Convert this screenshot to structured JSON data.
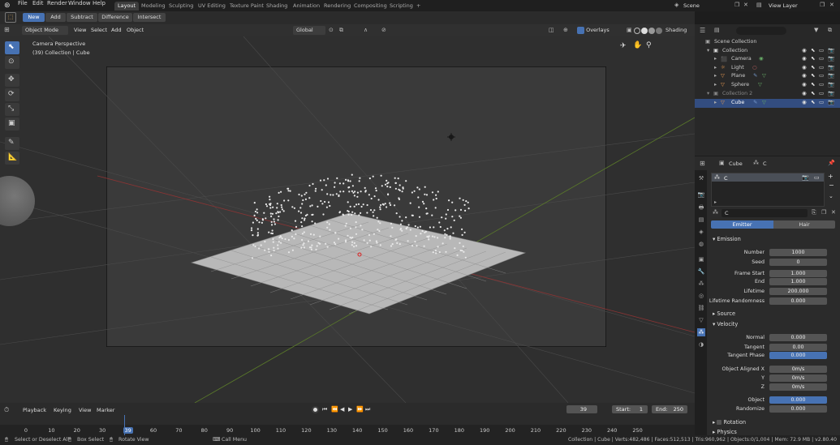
{
  "topbar": {
    "menus": [
      "File",
      "Edit",
      "Render",
      "Window",
      "Help"
    ],
    "workspaces": [
      "Layout",
      "Modeling",
      "Sculpting",
      "UV Editing",
      "Texture Paint",
      "Shading",
      "Animation",
      "Rendering",
      "Compositing",
      "Scripting"
    ],
    "active_workspace": "Layout",
    "add_workspace": "+",
    "scene_label": "Scene",
    "view_layer_label": "View Layer"
  },
  "toolheader": {
    "buttons": [
      "New",
      "Add",
      "Subtract",
      "Difference",
      "Intersect"
    ]
  },
  "viewport_header": {
    "mode": "Object Mode",
    "menus": [
      "View",
      "Select",
      "Add",
      "Object"
    ],
    "orientation": "Global",
    "overlays": "Overlays",
    "shading": "Shading"
  },
  "viewport": {
    "camera_info": "Camera Perspective",
    "collection_info": "(39) Collection | Cube"
  },
  "outliner": {
    "scene_collection": "Scene Collection",
    "items": [
      {
        "name": "Collection",
        "indent": 1
      },
      {
        "name": "Camera",
        "indent": 2
      },
      {
        "name": "Light",
        "indent": 2
      },
      {
        "name": "Plane",
        "indent": 2
      },
      {
        "name": "Sphere",
        "indent": 2
      },
      {
        "name": "Collection 2",
        "indent": 1
      },
      {
        "name": "Cube",
        "indent": 2,
        "selected": true
      }
    ]
  },
  "properties": {
    "object_name": "Cube",
    "particle_tab_label": "C",
    "slot_name": "C",
    "system_name": "C",
    "type_emitter": "Emitter",
    "type_hair": "Hair",
    "emission_header": "Emission",
    "emission": [
      {
        "label": "Number",
        "value": "1000"
      },
      {
        "label": "Seed",
        "value": "0"
      },
      {
        "label": "Frame Start",
        "value": "1.000"
      },
      {
        "label": "End",
        "value": "1.000"
      },
      {
        "label": "Lifetime",
        "value": "200.000"
      },
      {
        "label": "Lifetime Randomness",
        "value": "0.000"
      }
    ],
    "source_header": "Source",
    "velocity_header": "Velocity",
    "velocity": [
      {
        "label": "Normal",
        "value": "0.000"
      },
      {
        "label": "Tangent",
        "value": "0.00"
      },
      {
        "label": "Tangent Phase",
        "value": "0.000",
        "highlight": true
      },
      {
        "label": "Object Aligned X",
        "value": "0m/s"
      },
      {
        "label": "Y",
        "value": "0m/s"
      },
      {
        "label": "Z",
        "value": "0m/s"
      },
      {
        "label": "Object",
        "value": "0.000",
        "highlight": true
      },
      {
        "label": "Randomize",
        "value": "0.000"
      }
    ],
    "rotation_header": "Rotation",
    "physics_header": "Physics"
  },
  "timeline": {
    "menus": [
      "Playback",
      "Keying",
      "View",
      "Marker"
    ],
    "current_frame": "39",
    "start_label": "Start:",
    "start": "1",
    "end_label": "End:",
    "end": "250",
    "ticks": [
      "0",
      "10",
      "20",
      "30",
      "39",
      "60",
      "70",
      "80",
      "90",
      "100",
      "110",
      "120",
      "130",
      "140",
      "150",
      "160",
      "170",
      "180",
      "190",
      "200",
      "210",
      "220",
      "230",
      "240",
      "250"
    ]
  },
  "status": {
    "hint1": "Select or Deselect All",
    "hint2": "Box Select",
    "hint3": "Rotate View",
    "hint4": "Call Menu",
    "stats": "Collection | Cube | Verts:482,486 | Faces:512,513 | Tris:960,962 | Objects:0/1,004 | Mem: 72.9 MB | v2.80.40"
  },
  "colors": {
    "accent": "#4772b3",
    "selected_row": "#334d80"
  }
}
